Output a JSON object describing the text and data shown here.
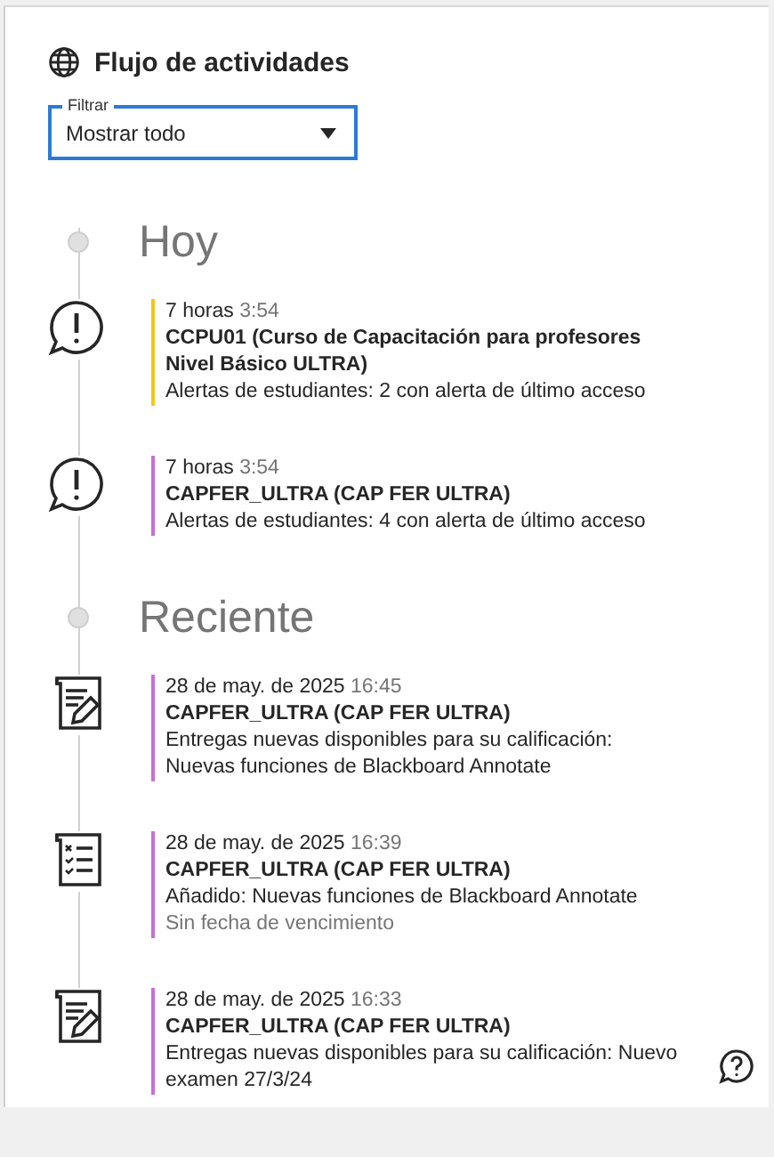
{
  "title": "Flujo de actividades",
  "filter": {
    "label": "Filtrar",
    "value": "Mostrar todo"
  },
  "sections": [
    {
      "heading": "Hoy",
      "items": [
        {
          "kind": "alert",
          "color": "#f2c71b",
          "date": "7 horas",
          "time": "3:54",
          "course": "CCPU01 (Curso de Capacitación para profesores Nivel Básico ULTRA)",
          "text": "Alertas de estudiantes: 2 con alerta de último acceso"
        },
        {
          "kind": "alert",
          "color": "#c76fd6",
          "date": "7 horas",
          "time": "3:54",
          "course": "CAPFER_ULTRA (CAP FER ULTRA)",
          "text": "Alertas de estudiantes: 4 con alerta de último acceso"
        }
      ]
    },
    {
      "heading": "Reciente",
      "items": [
        {
          "kind": "submission",
          "color": "#c76fd6",
          "date": "28 de may. de 2025",
          "time": "16:45",
          "course": "CAPFER_ULTRA (CAP FER ULTRA)",
          "text": "Entregas nuevas disponibles para su calificación: Nuevas funciones de Blackboard Annotate"
        },
        {
          "kind": "assignment",
          "color": "#c76fd6",
          "date": "28 de may. de 2025",
          "time": "16:39",
          "course": "CAPFER_ULTRA (CAP FER ULTRA)",
          "text": "Añadido: Nuevas funciones de Blackboard Annotate",
          "note": "Sin fecha de vencimiento"
        },
        {
          "kind": "submission",
          "color": "#c76fd6",
          "date": "28 de may. de 2025",
          "time": "16:33",
          "course": "CAPFER_ULTRA (CAP FER ULTRA)",
          "text": "Entregas nuevas disponibles para su calificación: Nuevo examen 27/3/24"
        }
      ]
    }
  ]
}
